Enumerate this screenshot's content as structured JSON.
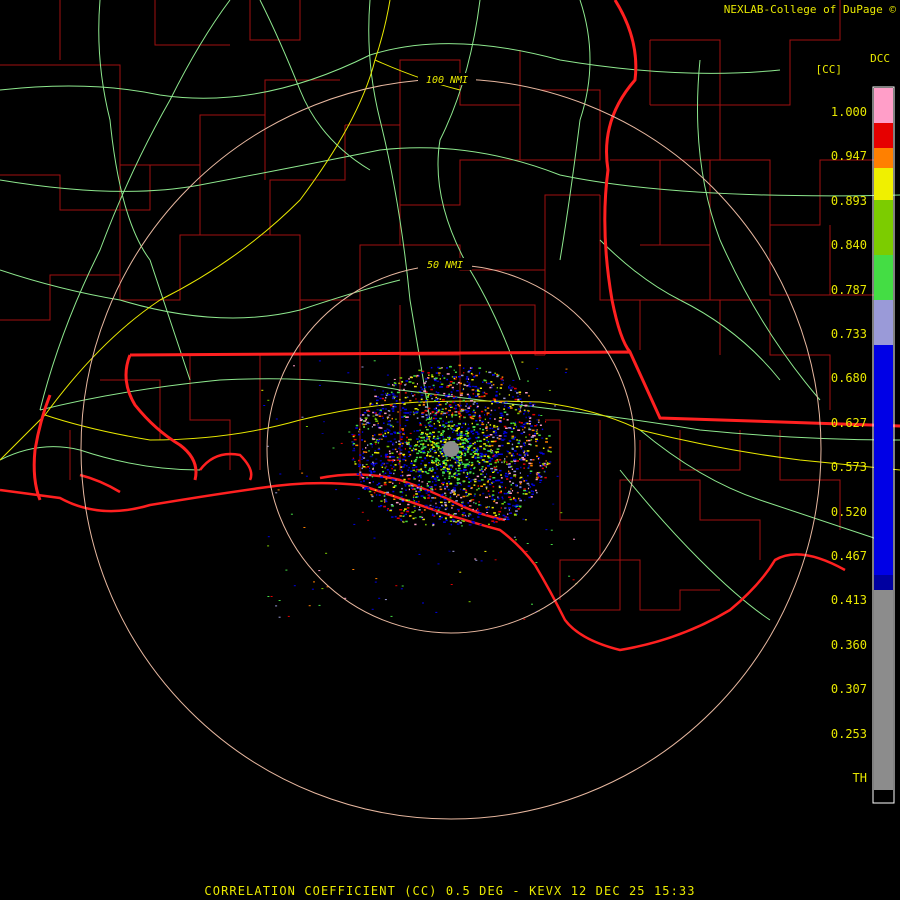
{
  "product": {
    "title": "CORRELATION COEFFICIENT (CC) 0.5 DEG - KEVX 12 DEC 25 15:33",
    "credit": "NEXLAB-College of DuPage",
    "credit_mark": "©",
    "brand": "DCC",
    "units": "[CC]"
  },
  "range_rings": [
    {
      "label": "50 NMI"
    },
    {
      "label": "100 NMI"
    }
  ],
  "legend": {
    "labels": [
      "1.000",
      "0.947",
      "0.893",
      "0.840",
      "0.787",
      "0.733",
      "0.680",
      "0.627",
      "0.573",
      "0.520",
      "0.467",
      "0.413",
      "0.360",
      "0.307",
      "0.253",
      "TH"
    ],
    "colors": {
      "pink": "#ff9ec8",
      "red": "#e60000",
      "orange": "#ff8000",
      "yellow": "#f0f000",
      "green": "#7ccc00",
      "light_green": "#44dd44",
      "lavender": "#9a9ad8",
      "blue": "#0000e6",
      "navy": "#0000a0",
      "gray": "#8c8c8c",
      "black": "#000000"
    }
  },
  "map_colors": {
    "county": "#b01010",
    "state": "#ff2020",
    "highway": "#8ee88e",
    "interstate": "#e8e800",
    "ring": "#e8b8a0"
  }
}
